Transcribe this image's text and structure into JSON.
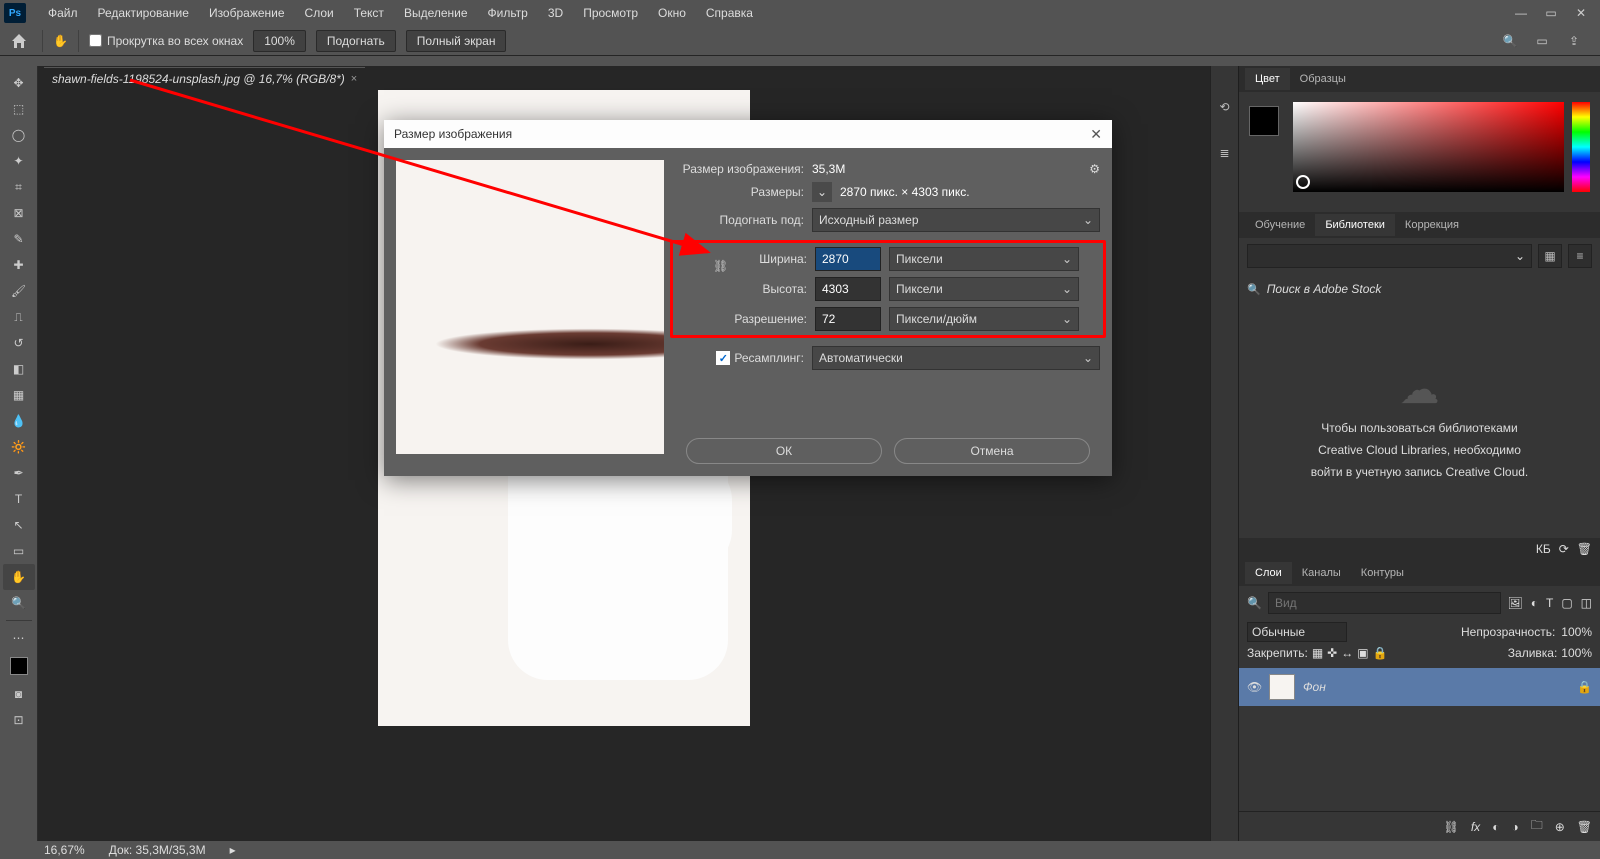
{
  "menu": {
    "items": [
      "Файл",
      "Редактирование",
      "Изображение",
      "Слои",
      "Текст",
      "Выделение",
      "Фильтр",
      "3D",
      "Просмотр",
      "Окно",
      "Справка"
    ]
  },
  "options": {
    "scroll_all": "Прокрутка во всех окнах",
    "zoom": "100%",
    "fit": "Подогнать",
    "fullscreen": "Полный экран"
  },
  "tab": {
    "title": "shawn-fields-1198524-unsplash.jpg @ 16,7% (RGB/8*)"
  },
  "status": {
    "zoom": "16,67%",
    "doc": "Док: 35,3M/35,3M"
  },
  "panels": {
    "color": {
      "tab1": "Цвет",
      "tab2": "Образцы"
    },
    "libs": {
      "tab1": "Обучение",
      "tab2": "Библиотеки",
      "tab3": "Коррекция",
      "stock_placeholder": "Поиск в Adobe Stock",
      "msg1": "Чтобы пользоваться библиотеками",
      "msg2": "Creative Cloud Libraries, необходимо",
      "msg3": "войти в учетную запись Creative Cloud.",
      "kb": "КБ"
    },
    "layers": {
      "tab1": "Слои",
      "tab2": "Каналы",
      "tab3": "Контуры",
      "find": "Вид",
      "mode": "Обычные",
      "opacity_label": "Непрозрачность:",
      "opacity": "100%",
      "lock_label": "Закрепить:",
      "fill_label": "Заливка:",
      "fill": "100%",
      "layer_name": "Фон"
    }
  },
  "dialog": {
    "title": "Размер изображения",
    "size_label": "Размер изображения:",
    "size_val": "35,3M",
    "dims_label": "Размеры:",
    "dims_val": "2870 пикс. × 4303 пикс.",
    "fit_label": "Подогнать под:",
    "fit_val": "Исходный размер",
    "width_label": "Ширина:",
    "width_val": "2870",
    "width_unit": "Пиксели",
    "height_label": "Высота:",
    "height_val": "4303",
    "height_unit": "Пиксели",
    "res_label": "Разрешение:",
    "res_val": "72",
    "res_unit": "Пиксели/дюйм",
    "resample_label": "Ресамплинг:",
    "resample_val": "Автоматически",
    "ok": "ОК",
    "cancel": "Отмена"
  }
}
